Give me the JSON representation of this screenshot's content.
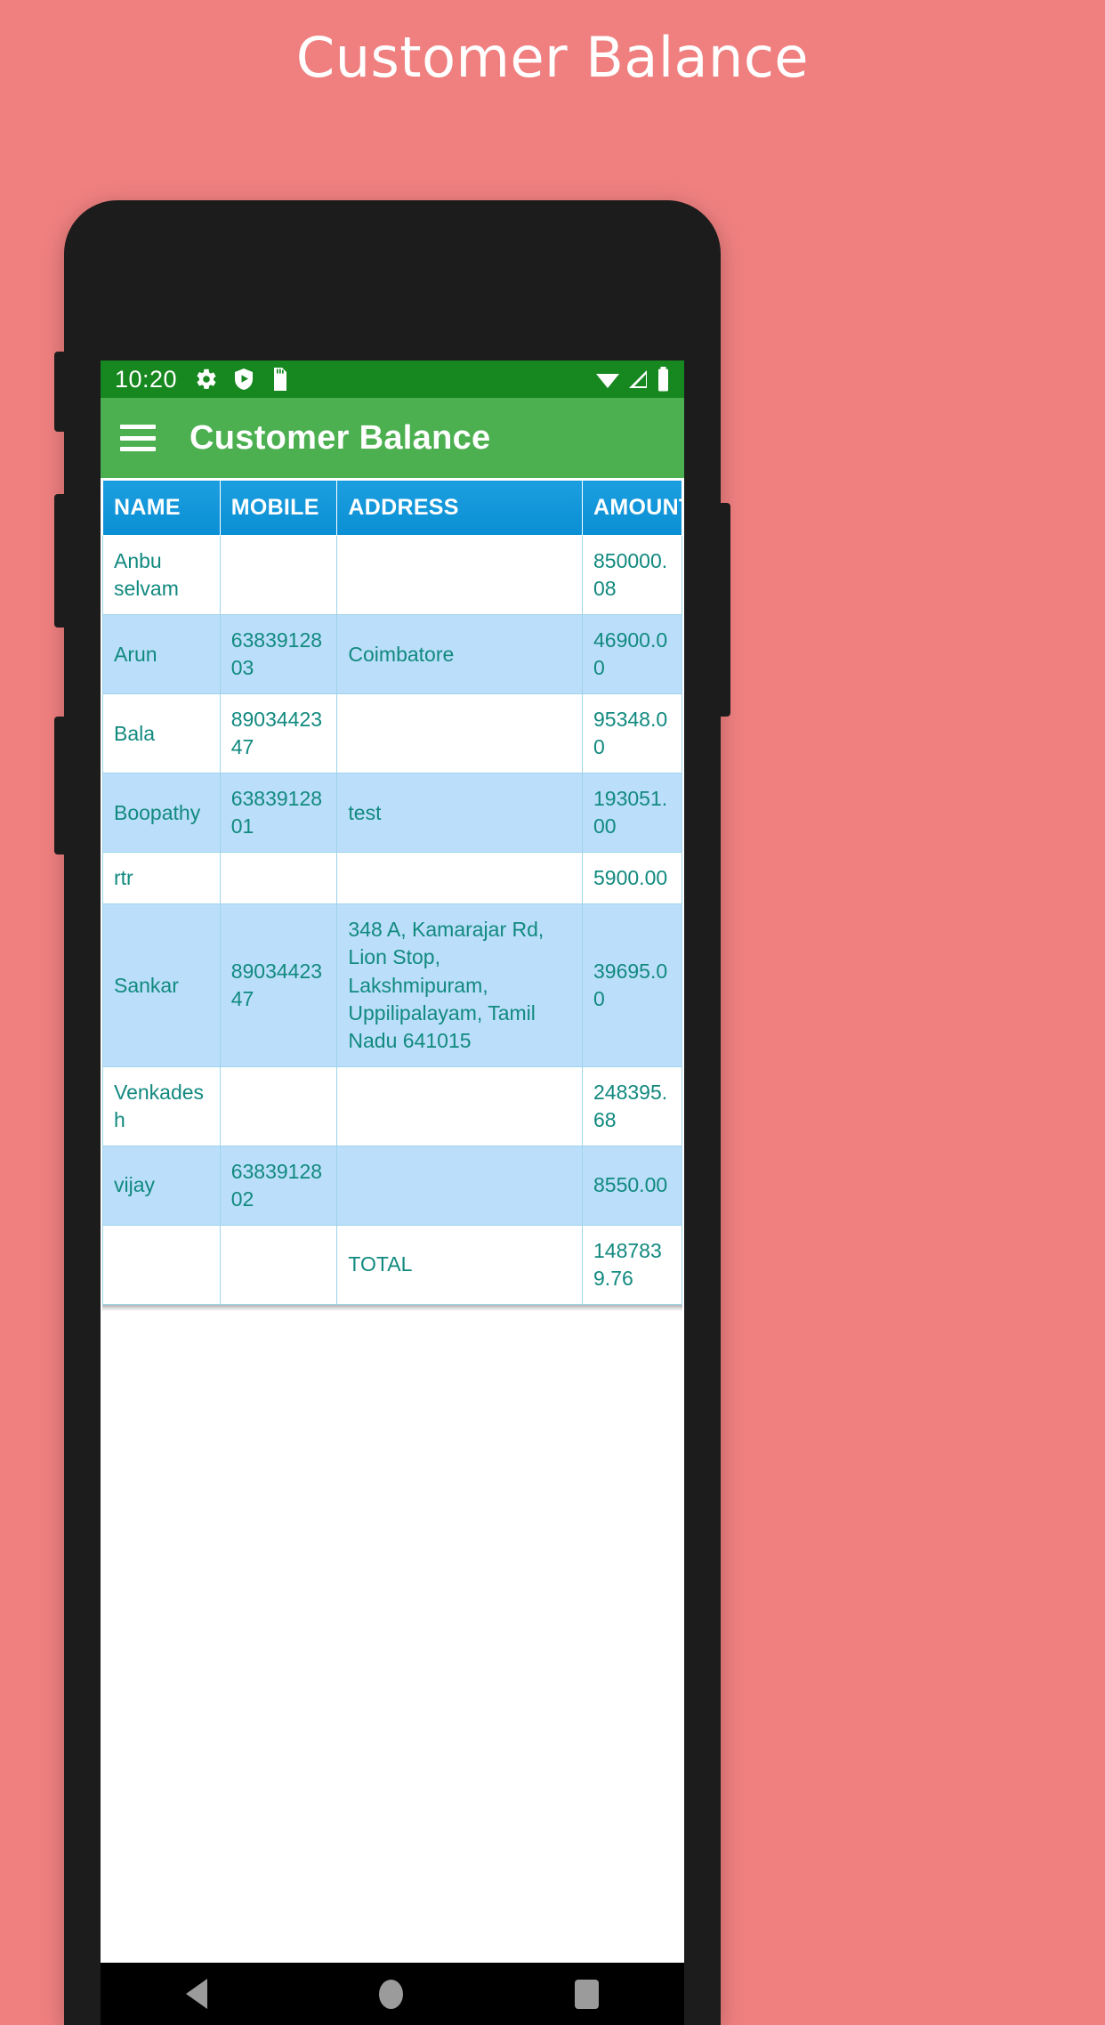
{
  "page": {
    "heading": "Customer Balance",
    "background_color": "#F08080",
    "heading_color": "#FFFFFF"
  },
  "status_bar": {
    "time": "10:20",
    "background_color": "#17871F",
    "left_icons": [
      "gear-icon",
      "shield-play-icon",
      "sd-card-icon"
    ],
    "right_icons": [
      "wifi-icon",
      "signal-icon",
      "battery-icon"
    ]
  },
  "app_bar": {
    "menu_icon": "hamburger-menu-icon",
    "title": "Customer Balance",
    "background_color": "#4CAF50",
    "title_color": "#FFFFFF"
  },
  "table": {
    "header_background_color": "#0B8FD4",
    "row_alt_background_color": "#BBDFFA",
    "text_color": "#11897F",
    "columns": [
      "NAME",
      "MOBILE",
      "ADDRESS",
      "AMOUNT"
    ],
    "rows": [
      {
        "name": "Anbu selvam",
        "mobile": "",
        "address": "",
        "amount": "850000.08"
      },
      {
        "name": "Arun",
        "mobile": "6383912803",
        "address": "Coimbatore",
        "amount": "46900.00"
      },
      {
        "name": "Bala",
        "mobile": "8903442347",
        "address": "",
        "amount": "95348.00"
      },
      {
        "name": "Boopathy",
        "mobile": "6383912801",
        "address": "test",
        "amount": "193051.00"
      },
      {
        "name": "rtr",
        "mobile": "",
        "address": "",
        "amount": "5900.00"
      },
      {
        "name": "Sankar",
        "mobile": "8903442347",
        "address": "348 A, Kamarajar Rd, Lion Stop, Lakshmipuram, Uppilipalayam, Tamil Nadu 641015",
        "amount": "39695.00"
      },
      {
        "name": "Venkadesh",
        "mobile": "",
        "address": "",
        "amount": "248395.68"
      },
      {
        "name": "vijay",
        "mobile": "6383912802",
        "address": "",
        "amount": "8550.00"
      }
    ],
    "total_row": {
      "name": "",
      "mobile": "",
      "address": "TOTAL",
      "amount": "1487839.76"
    }
  },
  "nav_bar": {
    "back": "back-triangle-icon",
    "home": "home-circle-icon",
    "recents": "recents-square-icon"
  }
}
